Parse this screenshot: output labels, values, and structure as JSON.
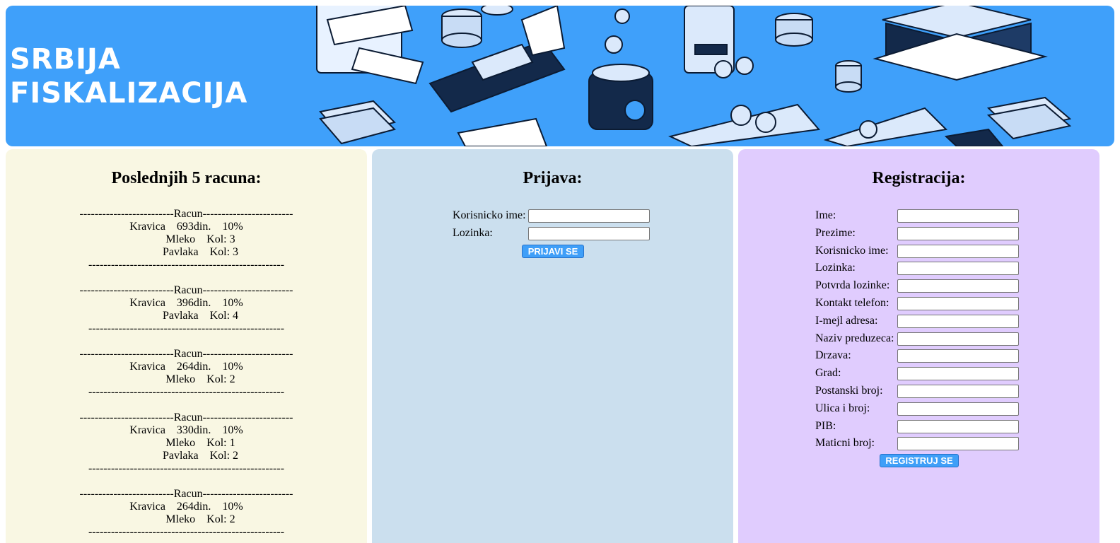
{
  "banner": {
    "title": "SRBIJA\nFISKALIZACIJA",
    "bg_color": "#3fa0fa"
  },
  "receipts_panel": {
    "heading": "Poslednjih 5 racuna:",
    "bg_color": "#f9f7e3",
    "receipts": [
      {
        "header": "-------------------------Racun------------------------",
        "summary": "Kravica    693din.    10%",
        "items": [
          "          Mleko    Kol: 3",
          "          Pavlaka    Kol: 3"
        ],
        "footer": "----------------------------------------------------"
      },
      {
        "header": "-------------------------Racun------------------------",
        "summary": "Kravica    396din.    10%",
        "items": [
          "          Pavlaka    Kol: 4"
        ],
        "footer": "----------------------------------------------------"
      },
      {
        "header": "-------------------------Racun------------------------",
        "summary": "Kravica    264din.    10%",
        "items": [
          "          Mleko    Kol: 2"
        ],
        "footer": "----------------------------------------------------"
      },
      {
        "header": "-------------------------Racun------------------------",
        "summary": "Kravica    330din.    10%",
        "items": [
          "          Mleko    Kol: 1",
          "          Pavlaka    Kol: 2"
        ],
        "footer": "----------------------------------------------------"
      },
      {
        "header": "-------------------------Racun------------------------",
        "summary": "Kravica    264din.    10%",
        "items": [
          "          Mleko    Kol: 2"
        ],
        "footer": "----------------------------------------------------"
      }
    ]
  },
  "login_panel": {
    "heading": "Prijava:",
    "bg_color": "#cbdfee",
    "fields": [
      {
        "label": "Korisnicko ime:",
        "value": ""
      },
      {
        "label": "Lozinka:",
        "value": ""
      }
    ],
    "submit_label": "PRIJAVI SE"
  },
  "register_panel": {
    "heading": "Registracija:",
    "bg_color": "#e0ccfe",
    "fields": [
      {
        "label": "Ime:",
        "value": ""
      },
      {
        "label": "Prezime:",
        "value": ""
      },
      {
        "label": "Korisnicko ime:",
        "value": ""
      },
      {
        "label": "Lozinka:",
        "value": ""
      },
      {
        "label": "Potvrda lozinke:",
        "value": ""
      },
      {
        "label": "Kontakt telefon:",
        "value": ""
      },
      {
        "label": "I-mejl adresa:",
        "value": ""
      },
      {
        "label": "Naziv preduzeca:",
        "value": ""
      },
      {
        "label": "Drzava:",
        "value": ""
      },
      {
        "label": "Grad:",
        "value": ""
      },
      {
        "label": "Postanski broj:",
        "value": ""
      },
      {
        "label": "Ulica i broj:",
        "value": ""
      },
      {
        "label": "PIB:",
        "value": ""
      },
      {
        "label": "Maticni broj:",
        "value": ""
      }
    ],
    "submit_label": "REGISTRUJ SE"
  },
  "colors": {
    "button": "#3f9ff8",
    "button_text": "#ffffff"
  },
  "icons": [
    "card-reader-icon",
    "coin-stack-icon",
    "bank-building-icon",
    "banknote-icon",
    "receipt-icon",
    "phone-cashback-icon",
    "coin-jar-icon"
  ]
}
